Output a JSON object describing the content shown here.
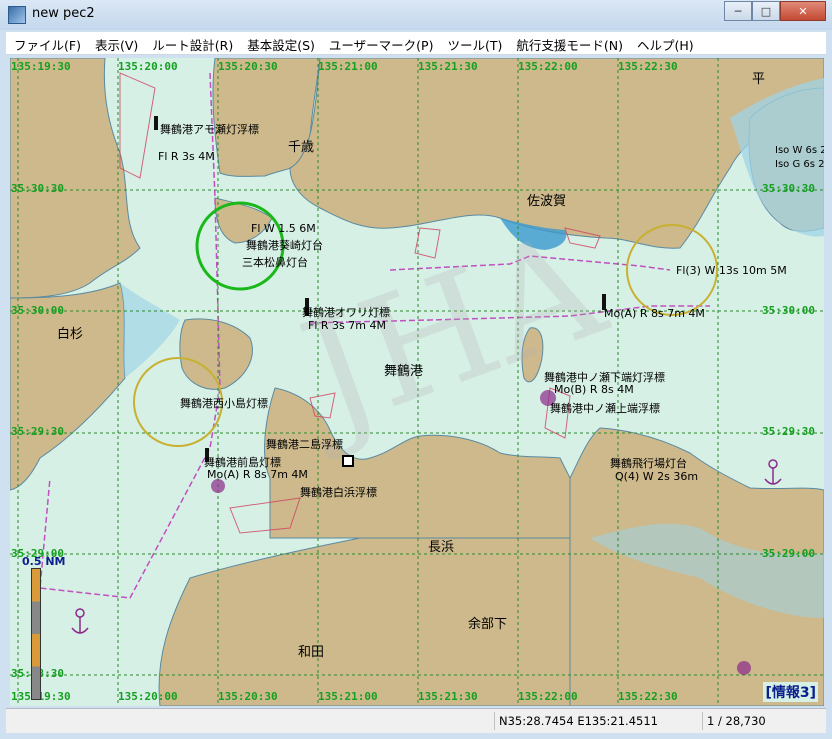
{
  "window": {
    "title": "new pec2",
    "min_glyph": "─",
    "max_glyph": "□",
    "close_glyph": "✕"
  },
  "menu": {
    "items": [
      "ファイル(F)",
      "表示(V)",
      "ルート設計(R)",
      "基本設定(S)",
      "ユーザーマーク(P)",
      "ツール(T)",
      "航行支援モード(N)",
      "ヘルプ(H)"
    ]
  },
  "map": {
    "top_coords": [
      "135:19:30",
      "135:20:00",
      "135:20:30",
      "135:21:00",
      "135:21:30",
      "135:22:00",
      "135:22:30"
    ],
    "bottom_coords": [
      "135:19:30",
      "135:20:00",
      "135:20:30",
      "135:21:00",
      "135:21:30",
      "135:22:00",
      "135:22:30"
    ],
    "left_coords": [
      "35:30:30",
      "35:30:00",
      "35:29:30",
      "35:29:00",
      "35:28:30"
    ],
    "right_coords": [
      "35:30:30",
      "35:30:00",
      "35:29:30",
      "35:29:00"
    ],
    "places": {
      "chitose": "千歳",
      "sabaka": "佐波賀",
      "shirasugi": "白杉",
      "maizuru": "舞鶴港",
      "nagahama": "長浜",
      "amabe": "余部下",
      "wada": "和田",
      "taira": "平"
    },
    "lights": [
      "舞鶴港アモ瀬灯浮標",
      "Fl R 3s 4M",
      "Fl W 1.5 6M",
      "舞鶴港葵崎灯台",
      "三本松鼻灯台",
      "Fl(3) W 13s 10m 5M",
      "舞鶴港オワリ灯標",
      "Fl R 3s 7m 4M",
      "Mo(A) R 8s 7m 4M",
      "舞鶴港中ノ瀬下端灯浮標",
      "Mo(B) R 8s 4M",
      "舞鶴港中ノ瀬上端浮標",
      "舞鶴港西小島灯標",
      "舞鶴港二島浮標",
      "舞鶴港前島灯標",
      "Mo(A) R 8s 7m 4M",
      "舞鶴港白浜浮標",
      "舞鶴飛行場灯台",
      "Q(4) W 2s 36m",
      "Iso W 6s 2",
      "Iso G 6s 2"
    ],
    "scale_label": "0.5 NM",
    "info_label": "[情報3]"
  },
  "status": {
    "position": "N35:28.7454 E135:21.4511",
    "scale": "1 / 28,730"
  },
  "colors": {
    "water": "#d7f0e6",
    "shallow": "#9fd4e6",
    "land": "#cdb98c",
    "grid": "#2a8a2a",
    "coord_text": "#14a020",
    "route": "#c050c0"
  }
}
